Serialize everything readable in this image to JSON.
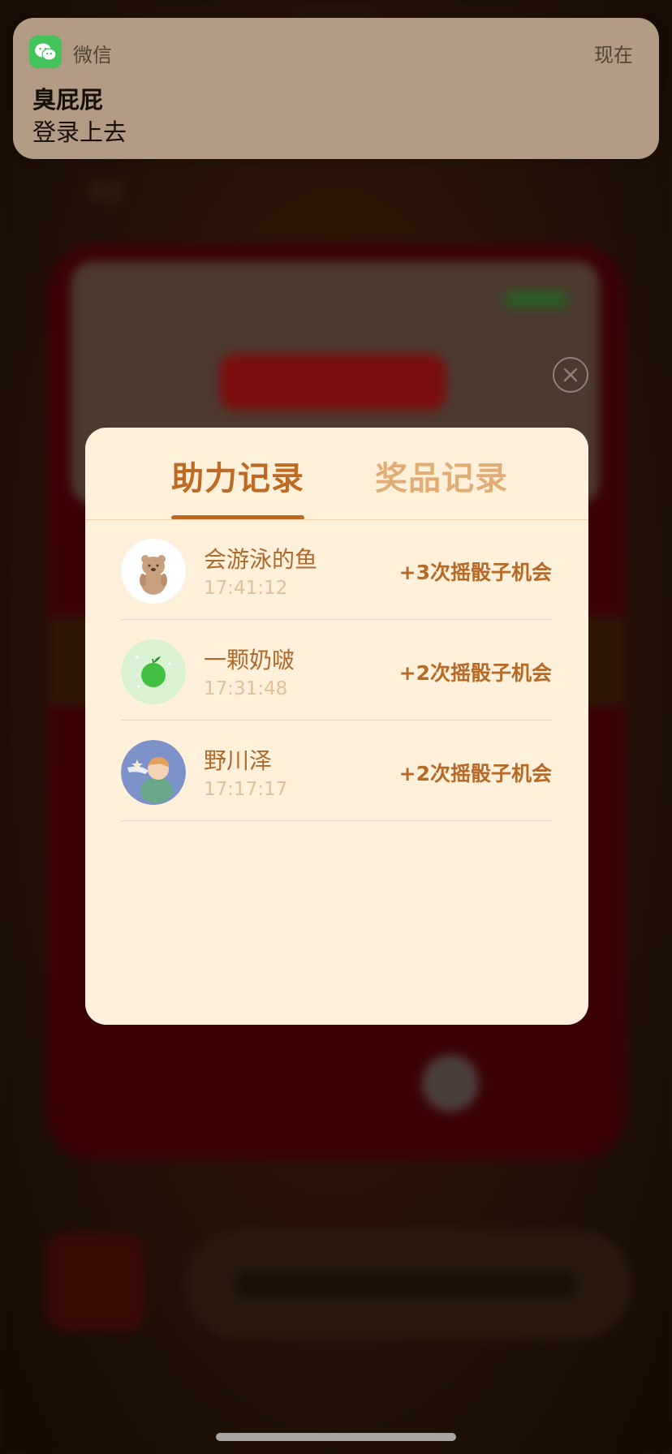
{
  "notification": {
    "app_name": "微信",
    "time": "现在",
    "title": "臭屁屁",
    "body": "登录上去"
  },
  "modal": {
    "tabs": [
      {
        "label": "助力记录",
        "active": true
      },
      {
        "label": "奖品记录",
        "active": false
      }
    ],
    "records": [
      {
        "name": "会游泳的鱼",
        "time": "17:41:12",
        "reward": "+3次摇骰子机会",
        "avatar": "bear-avatar-icon"
      },
      {
        "name": "一颗奶啵",
        "time": "17:31:48",
        "reward": "+2次摇骰子机会",
        "avatar": "green-apple-avatar-icon"
      },
      {
        "name": "野川泽",
        "time": "17:17:17",
        "reward": "+2次摇骰子机会",
        "avatar": "boy-avatar-icon"
      }
    ]
  },
  "colors": {
    "modal_bg": "#fff0dc",
    "tab_active": "#bd6a22",
    "tab_inactive": "#e0ad74",
    "reward": "#b76a26",
    "wechat_green": "#43c45a"
  },
  "icons": {
    "close": "close-icon",
    "wechat": "wechat-icon"
  }
}
